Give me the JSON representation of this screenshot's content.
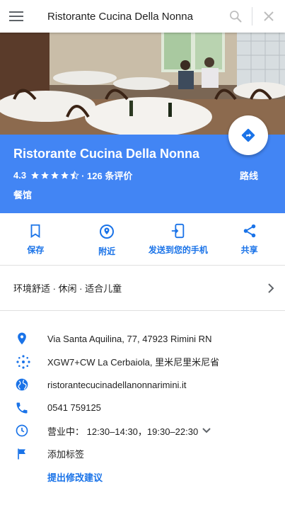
{
  "search": {
    "query": "Ristorante Cucina Della Nonna"
  },
  "place": {
    "name": "Ristorante Cucina Della Nonna",
    "rating": "4.3",
    "reviews": "· 126 条评价",
    "category": "餐馆",
    "directions_label": "路线"
  },
  "actions": [
    {
      "label": "保存",
      "icon": "bookmark-icon"
    },
    {
      "label": "附近",
      "icon": "nearby-icon"
    },
    {
      "label": "发送到您的手机",
      "icon": "send-to-phone-icon"
    },
    {
      "label": "共享",
      "icon": "share-icon"
    }
  ],
  "tags": "环境舒适 · 休闲 · 适合儿童",
  "details": {
    "address": "Via Santa Aquilina, 77, 47923 Rimini RN",
    "plus_code": "XGW7+CW La Cerbaiola, 里米尼里米尼省",
    "website": "ristorantecucinadellanonnarimini.it",
    "phone": "0541 759125",
    "hours": "营业中：  12:30–14:30，19:30–22:30",
    "add_label": "添加标签",
    "suggest_edit": "提出修改建议"
  },
  "colors": {
    "accent": "#4285f4",
    "link": "#1a73e8",
    "icon": "#1a73e8",
    "star": "#ffffff"
  }
}
